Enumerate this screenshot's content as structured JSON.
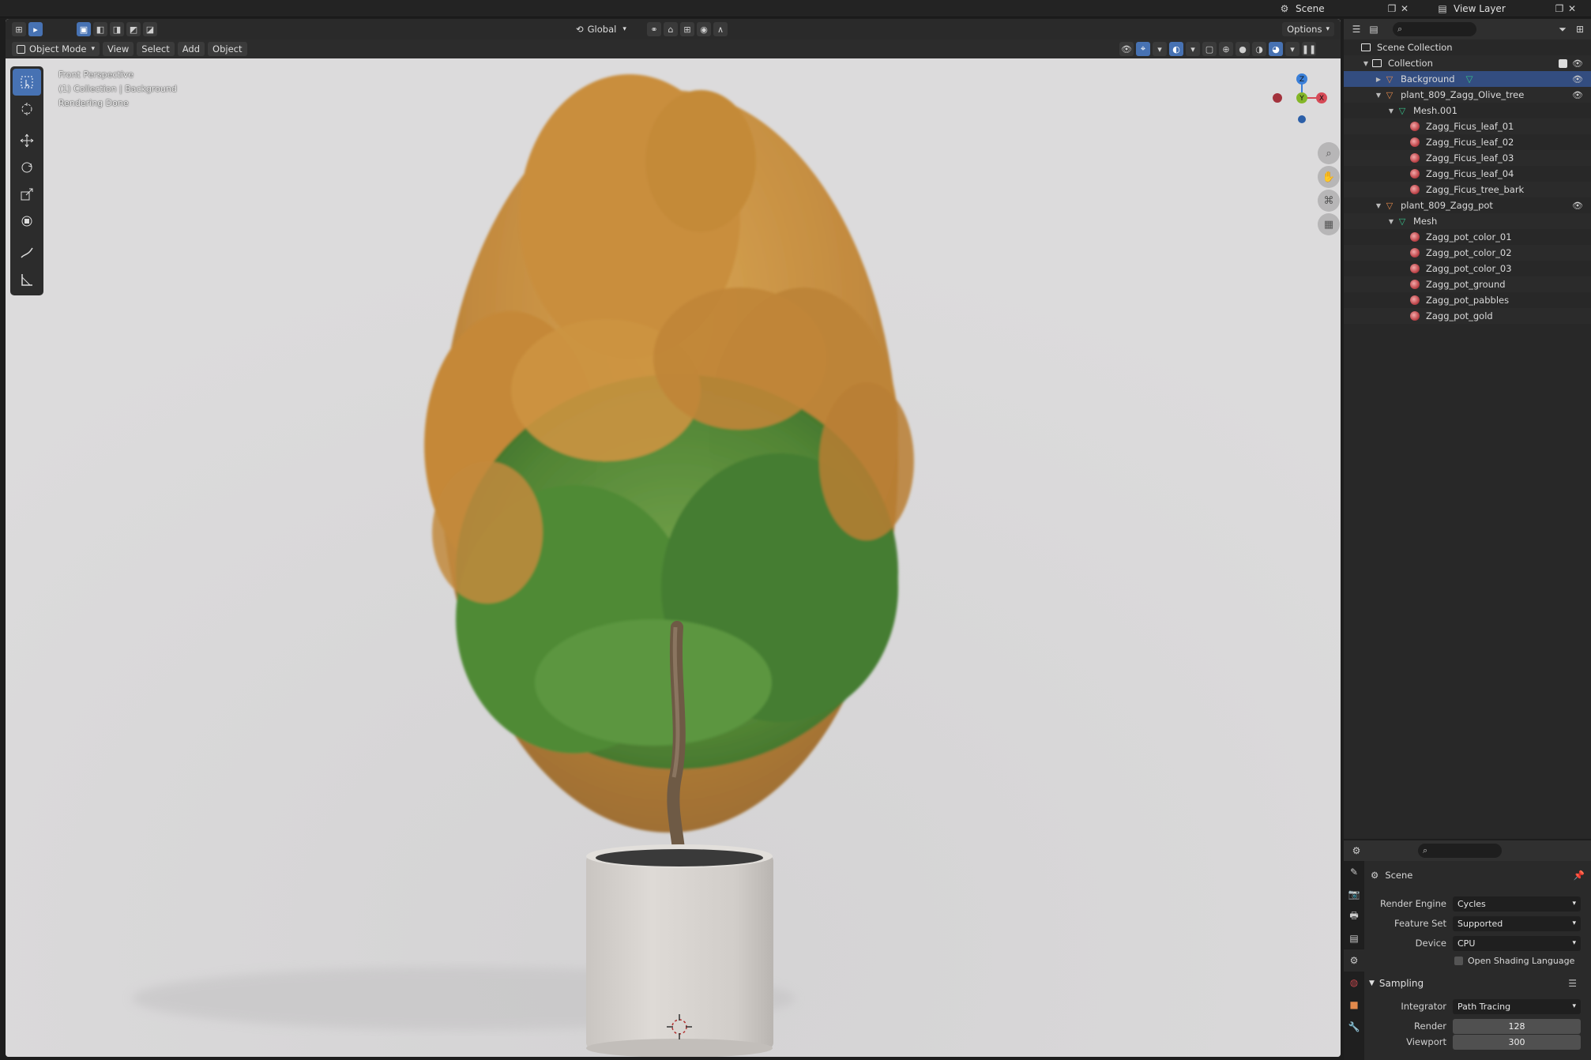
{
  "topbar": {
    "scene_label": "Scene",
    "view_layer_label": "View Layer"
  },
  "viewport": {
    "mode": "Object Mode",
    "menus": [
      "View",
      "Select",
      "Add",
      "Object"
    ],
    "transform_orientation": "Global",
    "options_label": "Options",
    "info": {
      "line1": "Front Perspective",
      "line2": "(1) Collection | Background",
      "line3": "Rendering Done"
    },
    "gizmo": {
      "z": "Z",
      "y": "Y",
      "x": "X"
    }
  },
  "outliner": {
    "rows": [
      {
        "label": "Scene Collection",
        "type": "scene-collection"
      },
      {
        "label": "Collection",
        "type": "collection"
      },
      {
        "label": "Background",
        "type": "object",
        "selected": true
      },
      {
        "label": "plant_809_Zagg_Olive_tree",
        "type": "object"
      },
      {
        "label": "Mesh.001",
        "type": "mesh"
      },
      {
        "label": "Zagg_Ficus_leaf_01",
        "type": "material"
      },
      {
        "label": "Zagg_Ficus_leaf_02",
        "type": "material"
      },
      {
        "label": "Zagg_Ficus_leaf_03",
        "type": "material"
      },
      {
        "label": "Zagg_Ficus_leaf_04",
        "type": "material"
      },
      {
        "label": "Zagg_Ficus_tree_bark",
        "type": "material"
      },
      {
        "label": "plant_809_Zagg_pot",
        "type": "object"
      },
      {
        "label": "Mesh",
        "type": "mesh"
      },
      {
        "label": "Zagg_pot_color_01",
        "type": "material"
      },
      {
        "label": "Zagg_pot_color_02",
        "type": "material"
      },
      {
        "label": "Zagg_pot_color_03",
        "type": "material"
      },
      {
        "label": "Zagg_pot_ground",
        "type": "material"
      },
      {
        "label": "Zagg_pot_pabbles",
        "type": "material"
      },
      {
        "label": "Zagg_pot_gold",
        "type": "material"
      }
    ]
  },
  "properties": {
    "context": "Scene",
    "render_engine": {
      "label": "Render Engine",
      "value": "Cycles"
    },
    "feature_set": {
      "label": "Feature Set",
      "value": "Supported"
    },
    "device": {
      "label": "Device",
      "value": "CPU"
    },
    "osl": {
      "label": "Open Shading Language",
      "checked": false
    },
    "sampling": {
      "title": "Sampling",
      "integrator": {
        "label": "Integrator",
        "value": "Path Tracing"
      },
      "render": {
        "label": "Render",
        "value": "128"
      },
      "viewport": {
        "label": "Viewport",
        "value": "300"
      }
    }
  },
  "colors": {
    "accent_blue": "#4772b3",
    "selected_row": "#334d80",
    "viewport_bg": "#d9d8d9"
  }
}
